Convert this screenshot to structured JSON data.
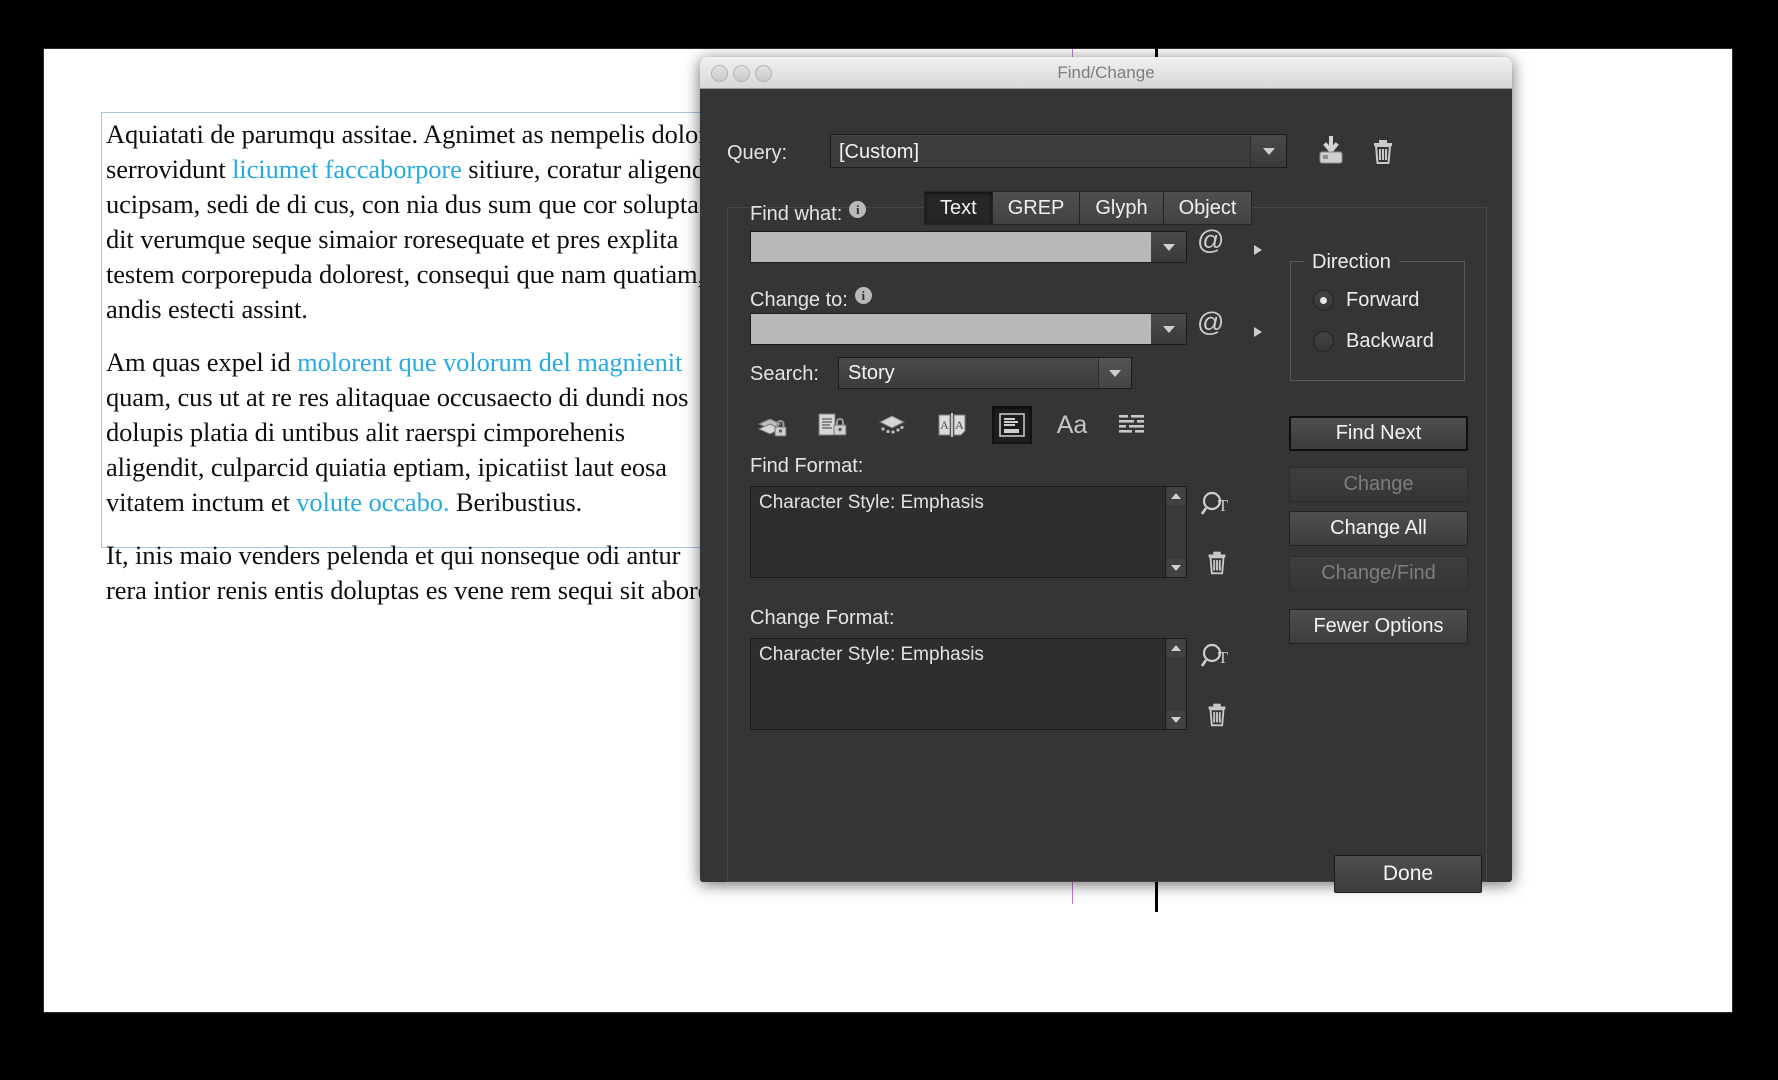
{
  "document": {
    "paragraphs": [
      [
        {
          "t": "Aquiatati de parumqu assitae. Agnimet as nempelis dolor serrovidunt ",
          "e": false
        },
        {
          "t": "liciumet faccaborpore",
          "e": true
        },
        {
          "t": " sitiure, coratur aligend ucipsam, sedi de di cus, con nia dus sum que cor solupta dit verumque seque simaior roresequate et pres explita testem corporepuda dolorest, consequi que nam quatiam, andis estecti assint.",
          "e": false
        }
      ],
      [
        {
          "t": "Am quas expel id ",
          "e": false
        },
        {
          "t": "molorent que volorum del magnienit",
          "e": true
        },
        {
          "t": " quam, cus ut at re res alitaquae occusaecto di dundi nos dolupis platia di untibus alit raerspi cimporehenis aligendit, culparcid quiatia eptiam, ipicatiist laut eosa vitatem inctum et ",
          "e": false
        },
        {
          "t": "volute occabo.",
          "e": true
        },
        {
          "t": " Beribustius.",
          "e": false
        }
      ],
      [
        {
          "t": "It, inis maio venders pelenda et qui nonseque odi antur rera intior renis entis doluptas es vene rem sequi sit abore.",
          "e": false
        }
      ]
    ],
    "emphasis_color": "#29abe2"
  },
  "dialog": {
    "title": "Find/Change",
    "query": {
      "label": "Query:",
      "value": "[Custom]",
      "save_icon": "save-query-icon",
      "delete_icon": "delete-query-icon"
    },
    "tabs": [
      {
        "label": "Text",
        "active": true
      },
      {
        "label": "GREP",
        "active": false
      },
      {
        "label": "Glyph",
        "active": false
      },
      {
        "label": "Object",
        "active": false
      }
    ],
    "find_what": {
      "label": "Find what:",
      "value": "",
      "placeholder": ""
    },
    "change_to": {
      "label": "Change to:",
      "value": "",
      "placeholder": ""
    },
    "search": {
      "label": "Search:",
      "value": "Story"
    },
    "toolbar_icons": [
      {
        "name": "include-locked-layers-icon",
        "selected": false
      },
      {
        "name": "include-locked-stories-icon",
        "selected": false
      },
      {
        "name": "include-hidden-layers-icon",
        "selected": false
      },
      {
        "name": "include-master-pages-icon",
        "selected": false
      },
      {
        "name": "include-footnotes-icon",
        "selected": true
      },
      {
        "name": "case-sensitive-icon",
        "selected": false
      },
      {
        "name": "whole-word-icon",
        "selected": false
      }
    ],
    "find_format": {
      "label": "Find Format:",
      "value": "Character Style: Emphasis"
    },
    "change_format": {
      "label": "Change Format:",
      "value": "Character Style: Emphasis"
    },
    "direction": {
      "legend": "Direction",
      "options": [
        {
          "label": "Forward",
          "selected": true
        },
        {
          "label": "Backward",
          "selected": false
        }
      ]
    },
    "buttons": [
      {
        "label": "Find Next",
        "state": "default"
      },
      {
        "label": "Change",
        "state": "disabled"
      },
      {
        "label": "Change All",
        "state": "enabled"
      },
      {
        "label": "Change/Find",
        "state": "disabled"
      },
      {
        "label": "Fewer Options",
        "state": "enabled"
      }
    ],
    "done_label": "Done"
  }
}
